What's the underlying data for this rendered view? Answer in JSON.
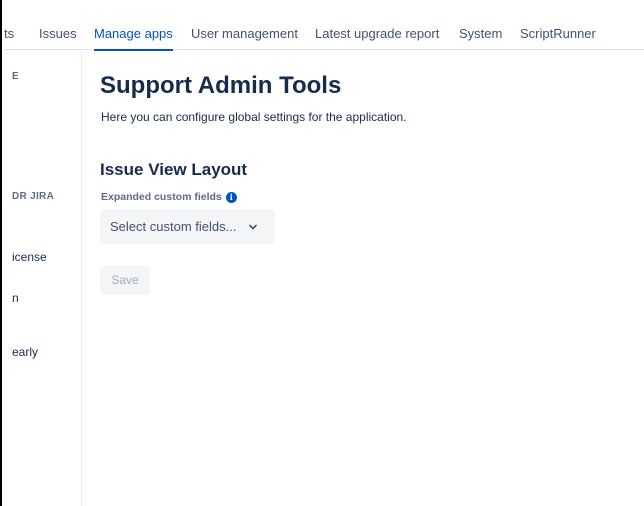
{
  "nav": {
    "tabs": [
      {
        "label": "ts"
      },
      {
        "label": "Issues"
      },
      {
        "label": "Manage apps"
      },
      {
        "label": "User management"
      },
      {
        "label": "Latest upgrade report"
      },
      {
        "label": "System"
      },
      {
        "label": "ScriptRunner"
      }
    ],
    "active_index": 2,
    "accent_color": "#0052cc"
  },
  "sidebar": {
    "headings": [
      "E",
      "DR JIRA"
    ],
    "items": [
      "icense",
      "n",
      "early"
    ]
  },
  "main": {
    "title": "Support Admin Tools",
    "description": "Here you can configure global settings for the application.",
    "section_title": "Issue View Layout",
    "field_label": "Expanded custom fields",
    "info_icon_glyph": "i",
    "select_placeholder": "Select custom fields...",
    "save_label": "Save"
  }
}
